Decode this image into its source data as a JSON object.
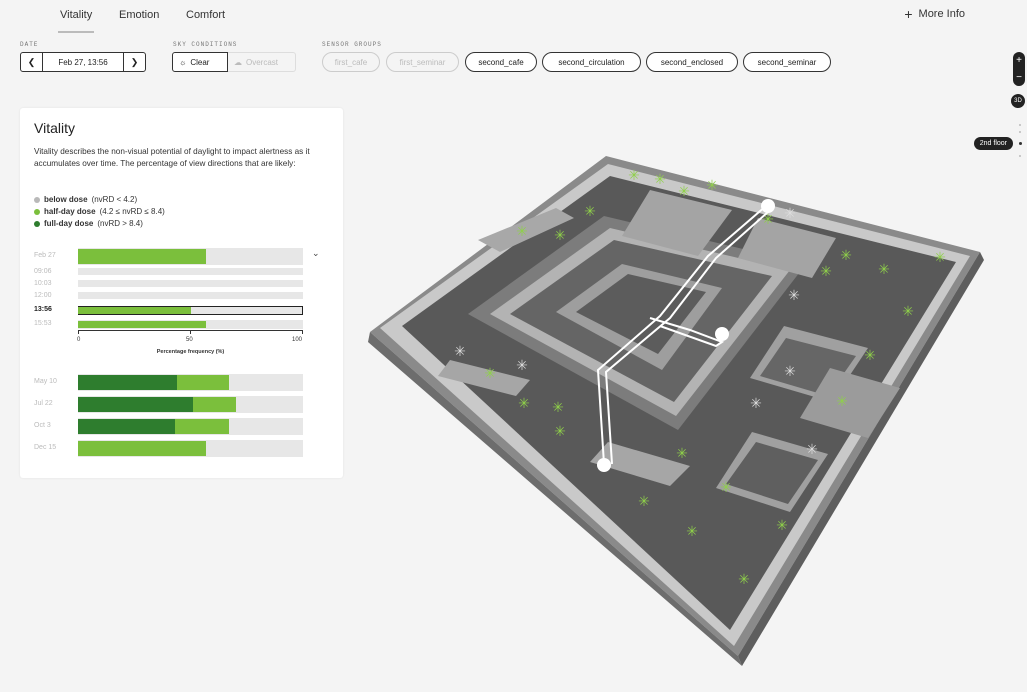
{
  "nav": {
    "tabs": [
      "Vitality",
      "Emotion",
      "Comfort"
    ],
    "active_tab": "Vitality",
    "more_info": "More Info",
    "more_info_icon": "plus-icon"
  },
  "controls": {
    "date_label": "DATE",
    "date_value": "Feb 27, 13:56",
    "prev_icon": "chevron-left-icon",
    "next_icon": "chevron-right-icon",
    "sky_label": "SKY CONDITIONS",
    "sky_options": [
      {
        "label": "Clear",
        "icon": "sun-icon",
        "selected": true
      },
      {
        "label": "Overcast",
        "icon": "cloud-icon",
        "selected": false
      }
    ],
    "sensor_label": "SENSOR GROUPS",
    "sensor_groups": [
      {
        "label": "first_cafe",
        "active": false
      },
      {
        "label": "first_seminar",
        "active": false
      },
      {
        "label": "second_cafe",
        "active": true
      },
      {
        "label": "second_circulation",
        "active": true
      },
      {
        "label": "second_enclosed",
        "active": true
      },
      {
        "label": "second_seminar",
        "active": true
      }
    ]
  },
  "map_controls": {
    "zoom_in": "+",
    "zoom_out": "−",
    "view_toggle": "3D",
    "floor": "2nd floor"
  },
  "panel": {
    "title": "Vitality",
    "description": "Vitality describes the non-visual potential of daylight to impact alertness as it accumulates over time. The percentage of view directions that are likely:",
    "legend": [
      {
        "name": "below dose",
        "range": "(nvRD < 4.2)",
        "color": "#b9b9b9"
      },
      {
        "name": "half-day dose",
        "range": "(4.2 ≤ nvRD ≤ 8.4)",
        "color": "#7bbf3c"
      },
      {
        "name": "full-day dose",
        "range": "(nvRD > 8.4)",
        "color": "#2e7d2e"
      }
    ],
    "axis_label": "Percentage frequency (%)",
    "axis_ticks": [
      "0",
      "50",
      "100"
    ]
  },
  "chart_data": {
    "type": "bar",
    "stacked": true,
    "xlim": [
      0,
      100
    ],
    "xlabel": "Percentage frequency (%)",
    "day_rows": [
      {
        "label": "Feb 27",
        "full": 0,
        "half": 57
      },
      {
        "label": "09:06",
        "full": 0,
        "half": 0
      },
      {
        "label": "10:03",
        "full": 0,
        "half": 0
      },
      {
        "label": "12:00",
        "full": 0,
        "half": 0
      },
      {
        "label": "13:56",
        "full": 0,
        "half": 50,
        "selected": true
      },
      {
        "label": "15:53",
        "full": 0,
        "half": 57
      }
    ],
    "season_rows": [
      {
        "label": "May 10",
        "full": 44,
        "half": 23
      },
      {
        "label": "Jul 22",
        "full": 51,
        "half": 19
      },
      {
        "label": "Oct 3",
        "full": 43,
        "half": 24
      },
      {
        "label": "Dec 15",
        "full": 0,
        "half": 57
      }
    ]
  }
}
